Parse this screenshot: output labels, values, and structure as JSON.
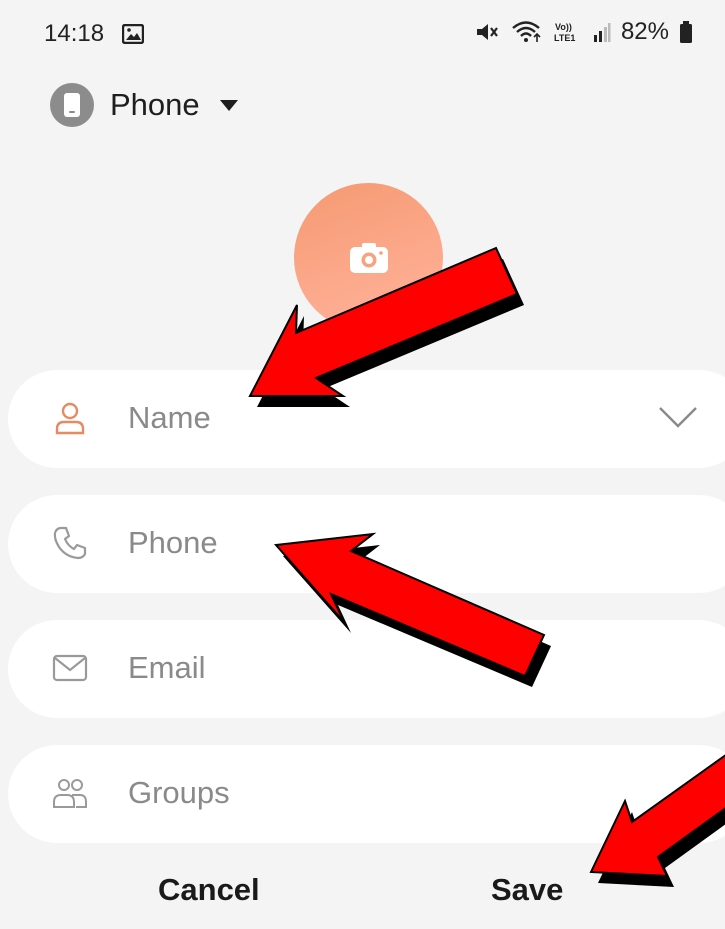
{
  "status_bar": {
    "time": "14:18",
    "battery": "82%",
    "icons": [
      "gallery-icon",
      "mute-icon",
      "wifi-icon",
      "volte-icon",
      "signal-icon",
      "battery-icon"
    ]
  },
  "account": {
    "label": "Phone",
    "icon": "phone-device-icon"
  },
  "photo": {
    "icon": "camera-icon",
    "accent": "#f7a07e"
  },
  "form": {
    "name_placeholder": "Name",
    "phone_placeholder": "Phone",
    "email_placeholder": "Email",
    "groups_placeholder": "Groups",
    "name_icon_color": "#e58a63",
    "icon_color": "#9a9a9a"
  },
  "actions": {
    "cancel_label": "Cancel",
    "save_label": "Save"
  },
  "annotations": {
    "arrow_color": "#ff0000"
  }
}
